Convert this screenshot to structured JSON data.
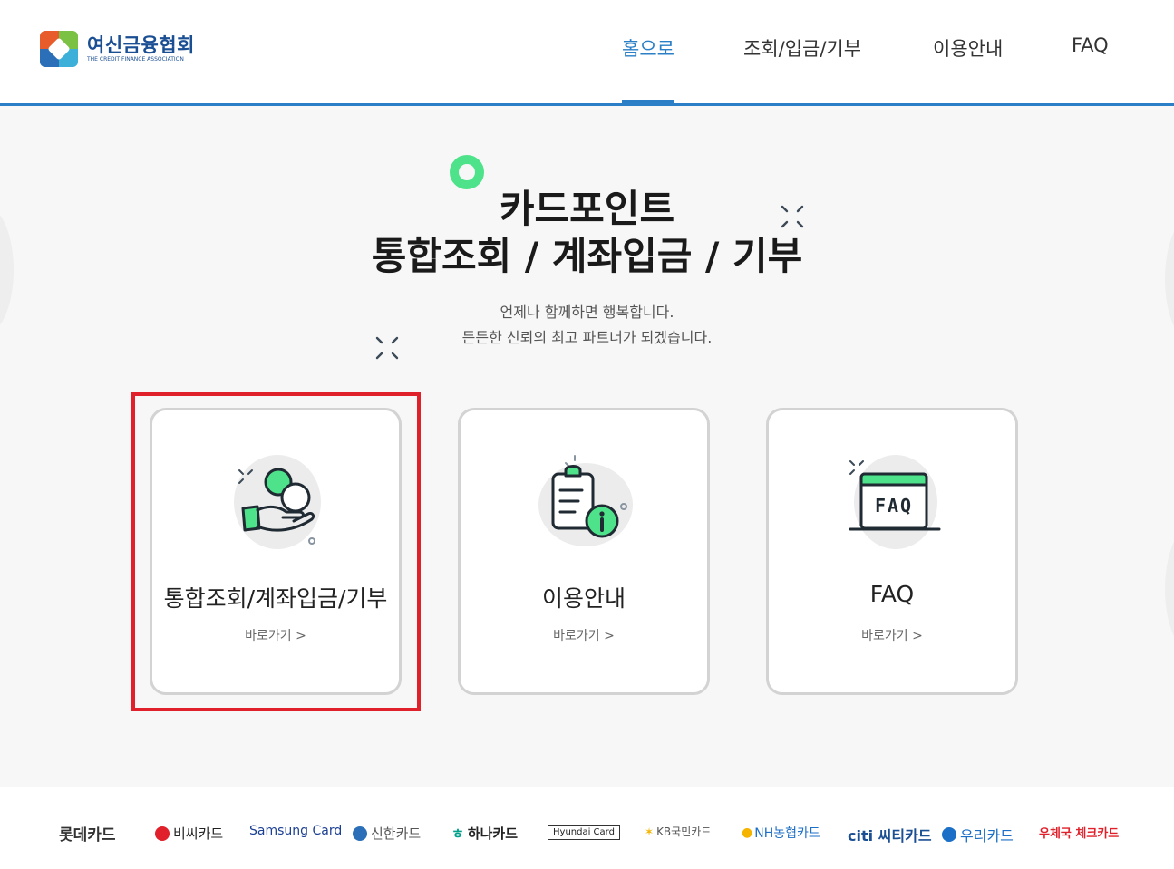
{
  "header": {
    "logo_ko": "여신금융협회",
    "logo_en": "THE CREDIT FINANCE ASSOCIATION",
    "nav": [
      "홈으로",
      "조회/입금/기부",
      "이용안내",
      "FAQ"
    ]
  },
  "hero": {
    "title_line1": "카드포인트",
    "title_line2": "통합조회 / 계좌입금 / 기부",
    "sub_line1": "언제나 함께하면 행복합니다.",
    "sub_line2": "든든한 신뢰의 최고 파트너가 되겠습니다."
  },
  "cards": [
    {
      "title": "통합조회/계좌입금/기부",
      "link": "바로가기 >",
      "icon": "coin-hand-icon"
    },
    {
      "title": "이용안내",
      "link": "바로가기 >",
      "icon": "clipboard-info-icon"
    },
    {
      "title": "FAQ",
      "link": "바로가기 >",
      "icon": "faq-window-icon"
    }
  ],
  "footer": {
    "brands": [
      "롯데카드",
      "비씨카드",
      "Samsung Card",
      "신한카드",
      "하나카드",
      "Hyundai Card",
      "KB국민카드",
      "NH농협카드",
      "citi 씨티카드",
      "우리카드",
      "우체국 체크카드"
    ]
  },
  "colors": {
    "accent": "#2a7fc6",
    "highlight": "#e0202a",
    "green": "#4ee38a"
  }
}
